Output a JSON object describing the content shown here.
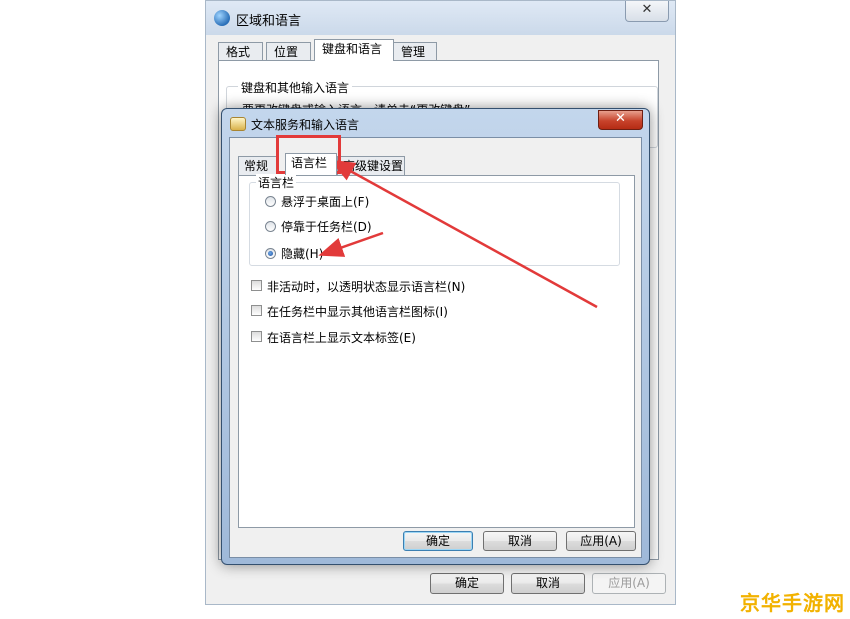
{
  "background_dialog": {
    "title": "区域和语言",
    "close_glyph": "✕",
    "tabs": [
      "格式",
      "位置",
      "键盘和语言",
      "管理"
    ],
    "active_tab": "键盘和语言",
    "group_title": "键盘和其他输入语言",
    "group_text": "要更改键盘或输入语言，请单击“更改键盘”",
    "buttons": {
      "ok": "确定",
      "cancel": "取消",
      "apply": "应用(A)"
    }
  },
  "dialog": {
    "title": "文本服务和输入语言",
    "close_glyph": "✕",
    "tabs": [
      "常规",
      "语言栏",
      "高级键设置"
    ],
    "active_tab": "语言栏",
    "group_title": "语言栏",
    "radios": [
      {
        "label": "悬浮于桌面上(F)",
        "checked": false
      },
      {
        "label": "停靠于任务栏(D)",
        "checked": false
      },
      {
        "label": "隐藏(H)",
        "checked": true
      }
    ],
    "checkboxes": [
      {
        "label": "非活动时，以透明状态显示语言栏(N)",
        "checked": false
      },
      {
        "label": "在任务栏中显示其他语言栏图标(I)",
        "checked": false
      },
      {
        "label": "在语言栏上显示文本标签(E)",
        "checked": false
      }
    ],
    "buttons": {
      "ok": "确定",
      "cancel": "取消",
      "apply": "应用(A)"
    }
  },
  "annotation_color": "#e23a3a",
  "watermark": "京华手游网"
}
